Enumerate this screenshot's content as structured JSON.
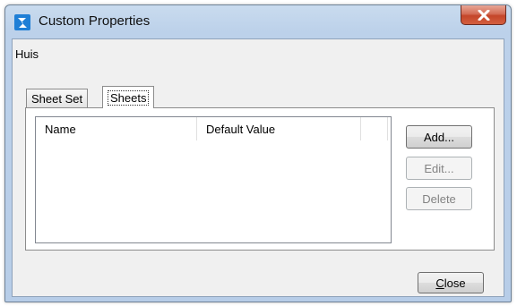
{
  "window": {
    "title": "Custom Properties",
    "app_icon": "bricscad-logo-icon",
    "close_icon": "close-icon",
    "accent_color": "#c4462a"
  },
  "content": {
    "sheet_set_name": "Huis",
    "tabs": [
      {
        "label": "Sheet Set",
        "selected": false
      },
      {
        "label": "Sheets",
        "selected": true
      }
    ],
    "table": {
      "columns": [
        "Name",
        "Default Value",
        ""
      ],
      "rows": []
    },
    "buttons": {
      "add": "Add...",
      "edit": "Edit...",
      "delete": "Delete"
    }
  },
  "footer": {
    "close_label_mnemonic": "C",
    "close_label_rest": "lose"
  }
}
